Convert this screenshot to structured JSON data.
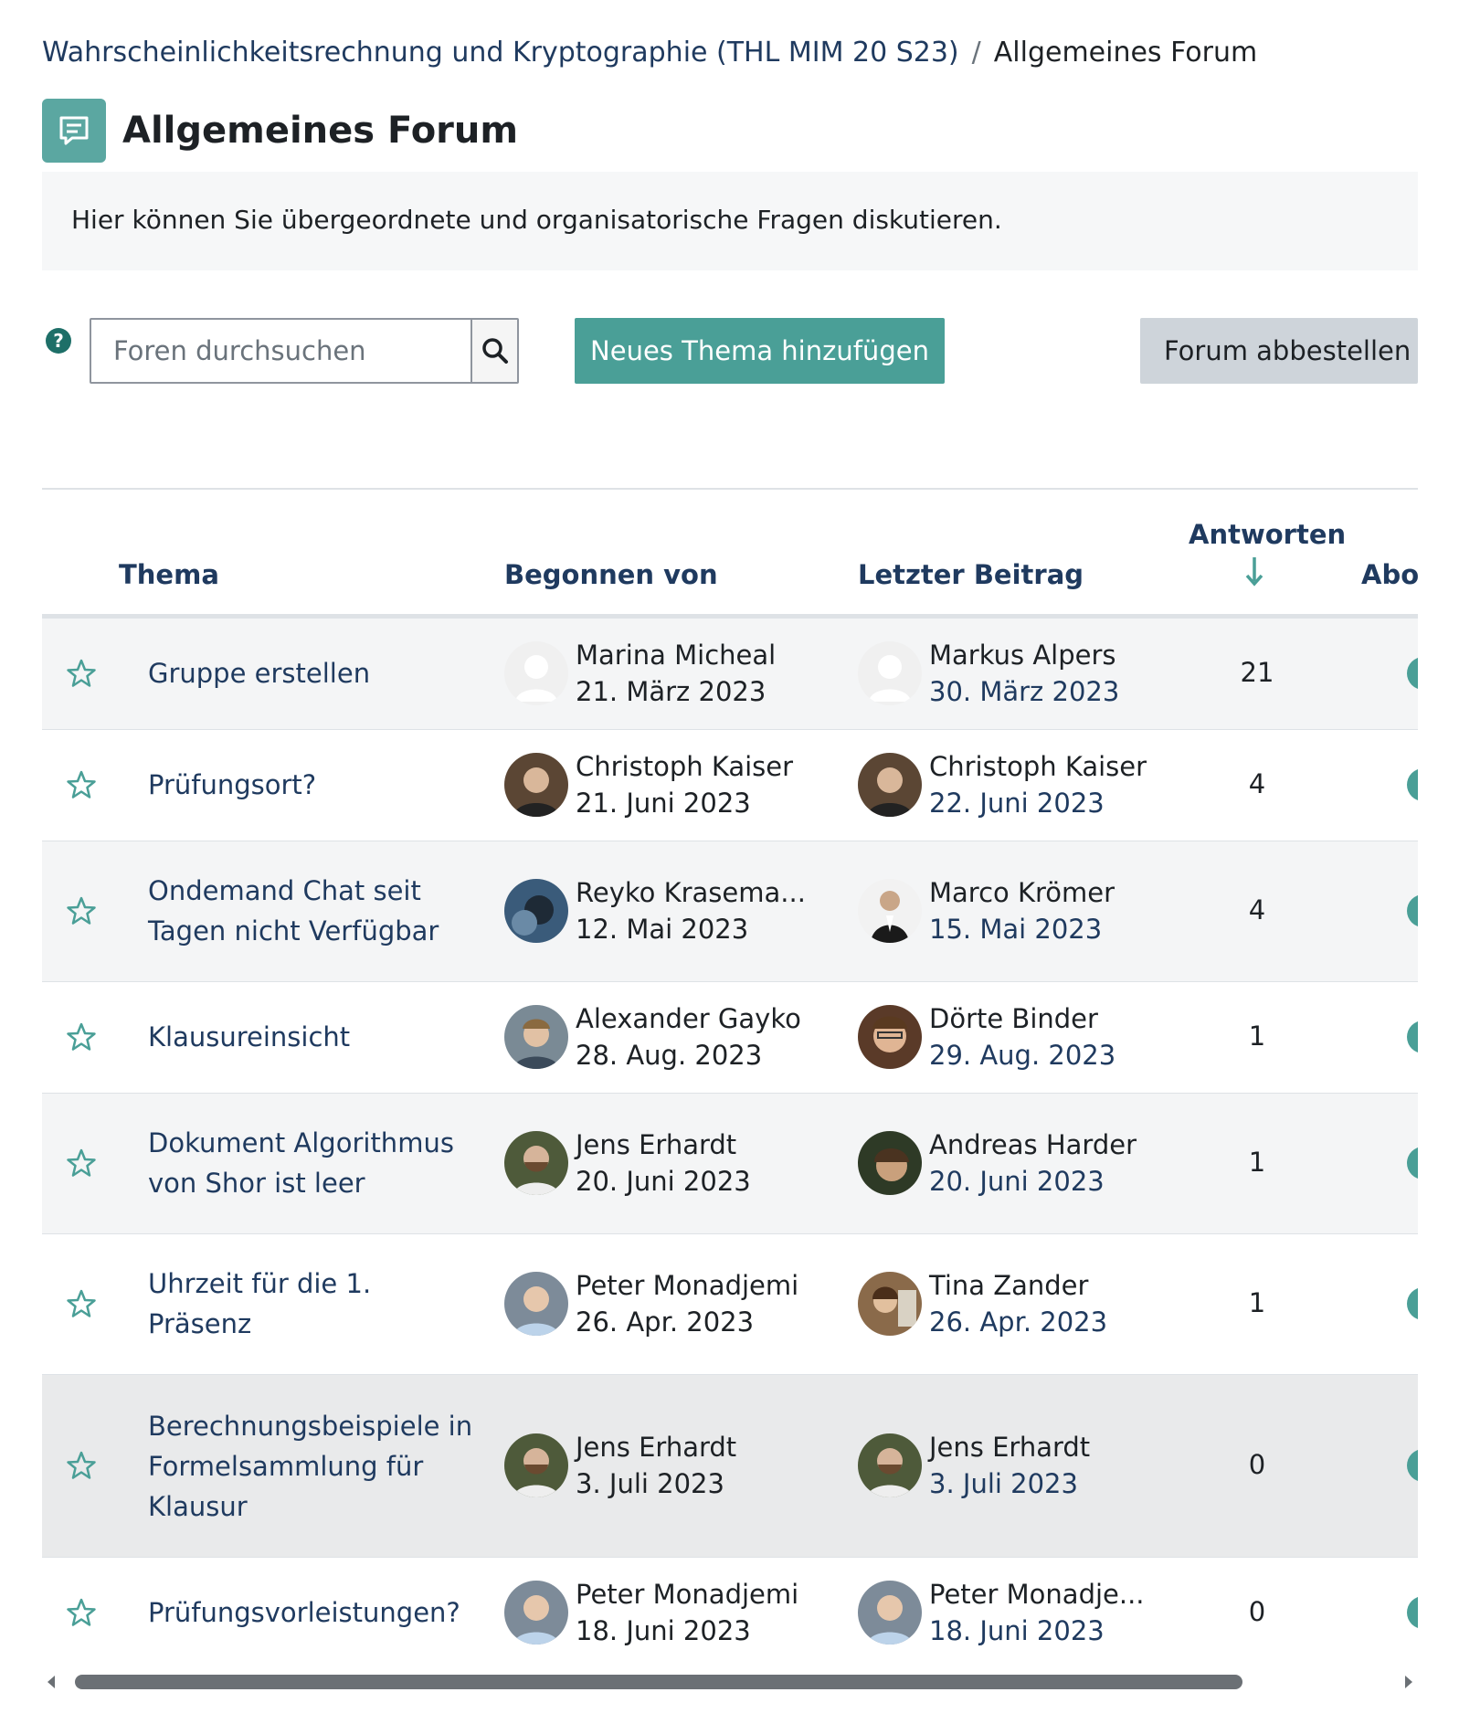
{
  "breadcrumb": {
    "course": "Wahrscheinlichkeitsrechnung und Kryptographie (THL MIM 20 S23)",
    "separator": "/",
    "current": "Allgemeines Forum"
  },
  "page_title": "Allgemeines Forum",
  "description": "Hier können Sie übergeordnete und organisatorische Fragen diskutieren.",
  "search": {
    "placeholder": "Foren durchsuchen"
  },
  "buttons": {
    "add_topic": "Neues Thema hinzufügen",
    "unsubscribe": "Forum abbestellen"
  },
  "table": {
    "headers": {
      "thema": "Thema",
      "begonnen": "Begonnen von",
      "letzter": "Letzter Beitrag",
      "antworten": "Antworten",
      "abo": "Abo"
    },
    "rows": [
      {
        "topic": "Gruppe erstellen",
        "starter": "Marina Micheal",
        "start_date": "21. März 2023",
        "last_author": "Markus Alpers",
        "last_date": "30. März 2023",
        "replies": "21"
      },
      {
        "topic": "Prüfungsort?",
        "starter": "Christoph Kaiser",
        "start_date": "21. Juni 2023",
        "last_author": "Christoph Kaiser",
        "last_date": "22. Juni 2023",
        "replies": "4"
      },
      {
        "topic": "Ondemand Chat seit Tagen nicht Verfügbar",
        "starter": "Reyko Krasema...",
        "start_date": "12. Mai 2023",
        "last_author": "Marco Krömer",
        "last_date": "15. Mai 2023",
        "replies": "4"
      },
      {
        "topic": "Klausureinsicht",
        "starter": "Alexander Gayko",
        "start_date": "28. Aug. 2023",
        "last_author": "Dörte Binder",
        "last_date": "29. Aug. 2023",
        "replies": "1"
      },
      {
        "topic": "Dokument Algorithmus von Shor ist leer",
        "starter": "Jens Erhardt",
        "start_date": "20. Juni 2023",
        "last_author": "Andreas Harder",
        "last_date": "20. Juni 2023",
        "replies": "1"
      },
      {
        "topic": "Uhrzeit für die 1. Präsenz",
        "starter": "Peter Monadjemi",
        "start_date": "26. Apr. 2023",
        "last_author": "Tina Zander",
        "last_date": "26. Apr. 2023",
        "replies": "1"
      },
      {
        "topic": "Berechnungsbeispiele in Formelsammlung für Klausur",
        "starter": "Jens Erhardt",
        "start_date": "3. Juli 2023",
        "last_author": "Jens Erhardt",
        "last_date": "3. Juli 2023",
        "replies": "0"
      },
      {
        "topic": "Prüfungsvorleistungen?",
        "starter": "Peter Monadjemi",
        "start_date": "18. Juni 2023",
        "last_author": "Peter Monadje...",
        "last_date": "18. Juni 2023",
        "replies": "0"
      }
    ]
  },
  "colors": {
    "accent": "#4a9f97",
    "link": "#1f3a5f",
    "icon_bg": "#5ba7a1"
  }
}
